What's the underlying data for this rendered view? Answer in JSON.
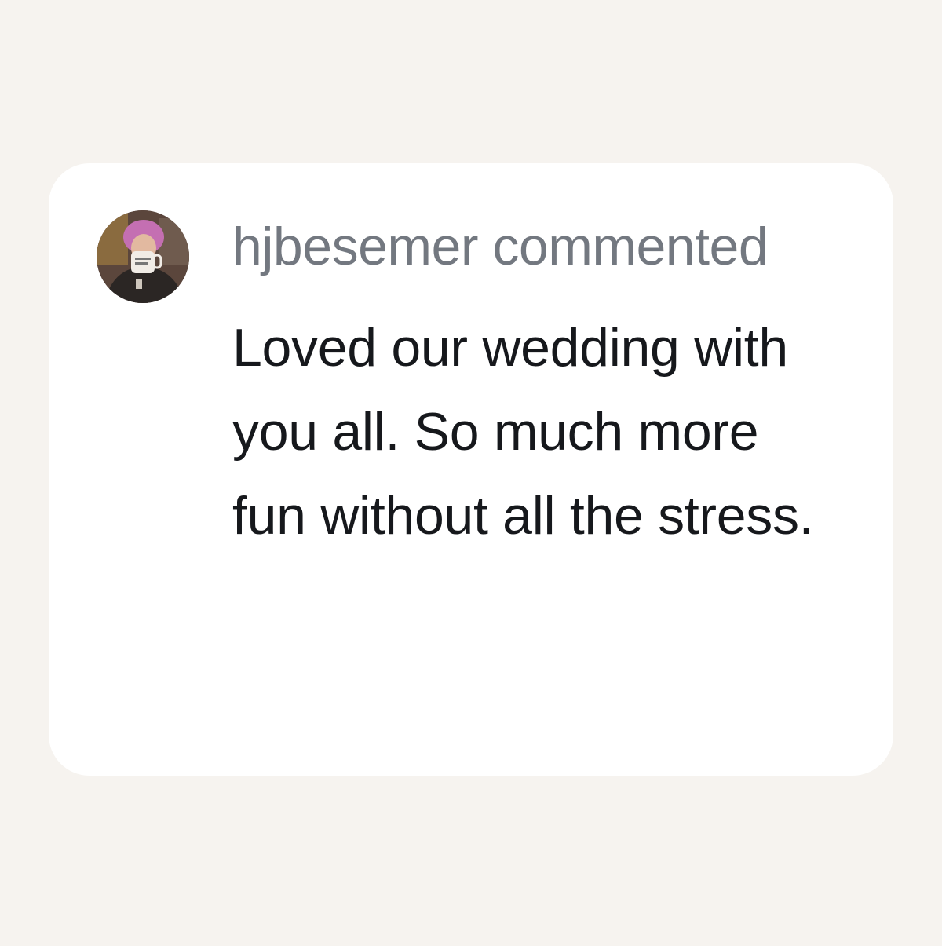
{
  "comment": {
    "author": "hjbesemer",
    "action": "commented",
    "header": "hjbesemer commented",
    "text": "Loved our wedding with you all. So much more fun without all the stress."
  },
  "avatar": {
    "icon": "user-photo-avatar"
  }
}
